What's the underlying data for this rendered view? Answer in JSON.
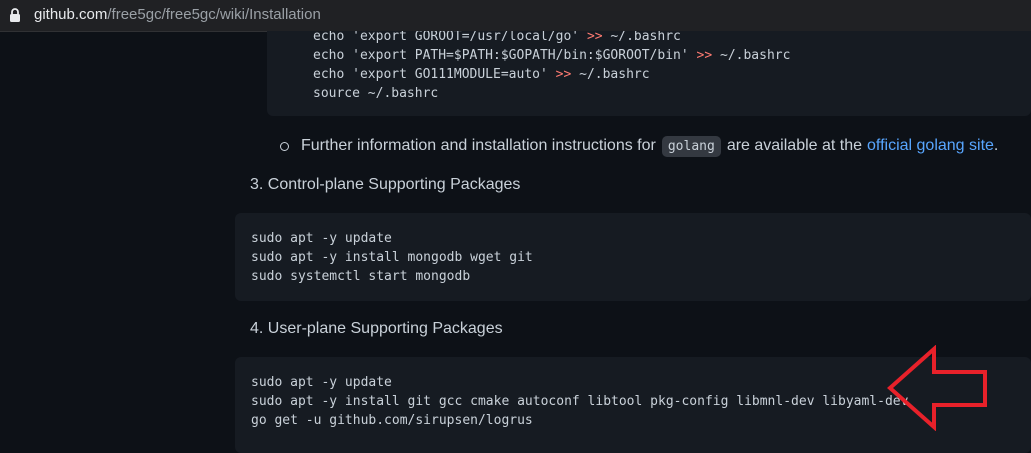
{
  "browser": {
    "url_host": "github.com",
    "url_path": "/free5gc/free5gc/wiki/Installation"
  },
  "code_block_1": {
    "lines": [
      {
        "cmd": "echo 'export GOROOT=/usr/local/go' ",
        "op": ">>",
        "target": " ~/.bashrc"
      },
      {
        "cmd": "echo 'export PATH=$PATH:$GOPATH/bin:$GOROOT/bin' ",
        "op": ">>",
        "target": " ~/.bashrc"
      },
      {
        "cmd": "echo 'export GO111MODULE=auto' ",
        "op": ">>",
        "target": " ~/.bashrc"
      },
      {
        "cmd": "source ~/.bashrc",
        "op": "",
        "target": ""
      }
    ]
  },
  "golang_note": {
    "text_before": "Further information and installation instructions for",
    "code": "golang",
    "text_after": "are available at the",
    "link": "official golang site",
    "end": "."
  },
  "section_3": {
    "heading": "3. Control-plane Supporting Packages",
    "lines": [
      "sudo apt -y update",
      "sudo apt -y install mongodb wget git",
      "sudo systemctl start mongodb"
    ]
  },
  "section_4": {
    "heading": "4. User-plane Supporting Packages",
    "lines": [
      "sudo apt -y update",
      "sudo apt -y install git gcc cmake autoconf libtool pkg-config libmnl-dev libyaml-dev",
      "go get -u github.com/sirupsen/logrus"
    ]
  },
  "annotation": {
    "arrow_color": "#e8212a"
  }
}
